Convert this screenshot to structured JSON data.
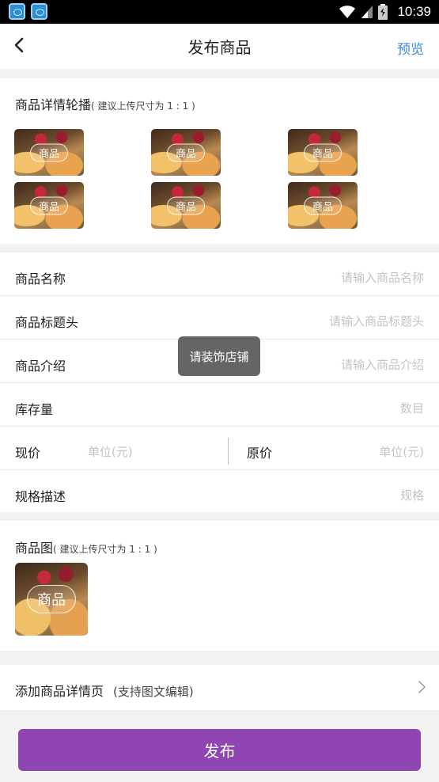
{
  "status_bar": {
    "time": "10:39",
    "icons": [
      "app-icon",
      "app-icon",
      "wifi-icon",
      "signal-icon",
      "battery-icon"
    ]
  },
  "nav": {
    "back_icon": "chevron-left-icon",
    "title": "发布商品",
    "preview": "预览"
  },
  "carousel": {
    "title": "商品详情轮播",
    "hint": "( 建议上传尺寸为 1 : 1 )",
    "thumb_label": "商品",
    "thumbs": [
      "商品",
      "商品",
      "商品",
      "商品",
      "商品",
      "商品"
    ]
  },
  "form": {
    "name": {
      "label": "商品名称",
      "placeholder": "请输入商品名称"
    },
    "headline": {
      "label": "商品标题头",
      "placeholder": "请输入商品标题头"
    },
    "intro": {
      "label": "商品介绍",
      "placeholder": "请输入商品介绍"
    },
    "stock": {
      "label": "库存量",
      "placeholder": "数目"
    },
    "current_price": {
      "label": "现价",
      "placeholder": "单位(元)"
    },
    "original_price": {
      "label": "原价",
      "placeholder": "单位(元)"
    },
    "spec": {
      "label": "规格描述",
      "placeholder": "规格"
    }
  },
  "toast": {
    "text": "请装饰店铺"
  },
  "product_image": {
    "title": "商品图",
    "hint": "( 建议上传尺寸为 1 : 1 )",
    "thumb_label": "商品"
  },
  "detail_page": {
    "label": "添加商品详情页",
    "note": "(支持图文编辑)",
    "icon": "chevron-right-icon"
  },
  "publish_button": "发布",
  "colors": {
    "accent": "#8f45b2",
    "link": "#3a8bd8",
    "background": "#f2f2f2"
  }
}
